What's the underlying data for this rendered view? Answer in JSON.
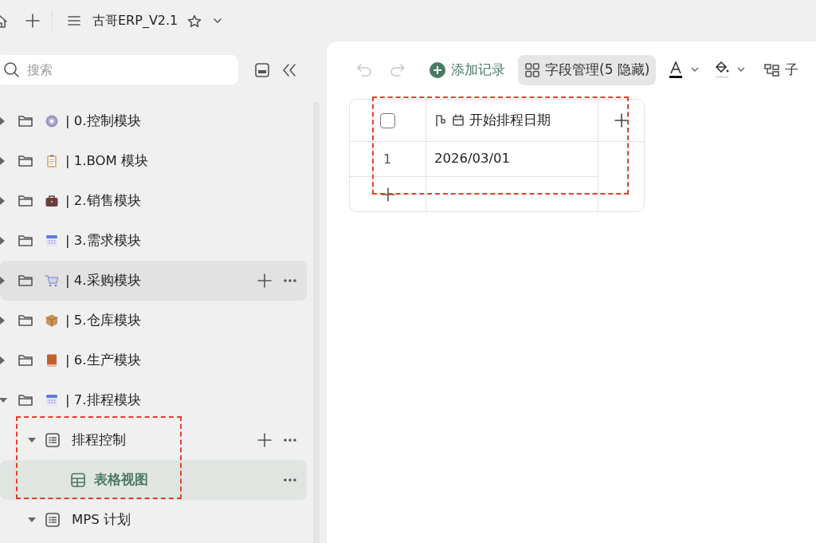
{
  "topbar": {
    "title": "古哥ERP_V2.1"
  },
  "sidebar": {
    "search": {
      "placeholder": "搜索"
    },
    "items": [
      {
        "label": "| 0.控制模块",
        "kind": "gear",
        "expanded": false,
        "hovered": false,
        "selected": false,
        "show_actions": false
      },
      {
        "label": "| 1.BOM 模块",
        "kind": "clipboard",
        "expanded": false,
        "hovered": false,
        "selected": false,
        "show_actions": false
      },
      {
        "label": "| 2.销售模块",
        "kind": "briefcase",
        "expanded": false,
        "hovered": false,
        "selected": false,
        "show_actions": false
      },
      {
        "label": "| 3.需求模块",
        "kind": "calendar",
        "expanded": false,
        "hovered": false,
        "selected": false,
        "show_actions": false
      },
      {
        "label": "| 4.采购模块",
        "kind": "cart",
        "expanded": false,
        "hovered": true,
        "selected": false,
        "show_actions": true
      },
      {
        "label": "| 5.仓库模块",
        "kind": "box",
        "expanded": false,
        "hovered": false,
        "selected": false,
        "show_actions": false
      },
      {
        "label": "| 6.生产模块",
        "kind": "book",
        "expanded": false,
        "hovered": false,
        "selected": false,
        "show_actions": false
      },
      {
        "label": "| 7.排程模块",
        "kind": "calendar",
        "expanded": true,
        "hovered": false,
        "selected": false,
        "show_actions": false,
        "children": [
          {
            "label": "排程控制",
            "kind": "doc",
            "expanded": true,
            "hovered": false,
            "selected": false,
            "show_actions": true,
            "children": [
              {
                "label": "表格视图",
                "kind": "grid",
                "selected": true,
                "show_actions": true
              }
            ]
          },
          {
            "label": "MPS 计划",
            "kind": "doc",
            "expanded": true,
            "hovered": false,
            "selected": false,
            "show_actions": false
          }
        ]
      }
    ]
  },
  "toolbar": {
    "undo": {
      "disabled": true
    },
    "redo": {
      "disabled": true
    },
    "buttons": [
      {
        "kind": "add",
        "label": "添加记录",
        "active": false
      },
      {
        "kind": "fields",
        "label": "字段管理(5 隐藏)",
        "active": true
      },
      {
        "kind": "text-color",
        "active": false
      },
      {
        "kind": "fill-color",
        "active": false
      },
      {
        "kind": "subtable",
        "label": "子",
        "active": false
      }
    ]
  },
  "table": {
    "header_checkbox": {
      "checked": false
    },
    "columns": [
      {
        "label": "开始排程日期"
      }
    ],
    "rows": [
      {
        "number": "1",
        "cells": [
          "2026/03/01"
        ]
      }
    ]
  }
}
